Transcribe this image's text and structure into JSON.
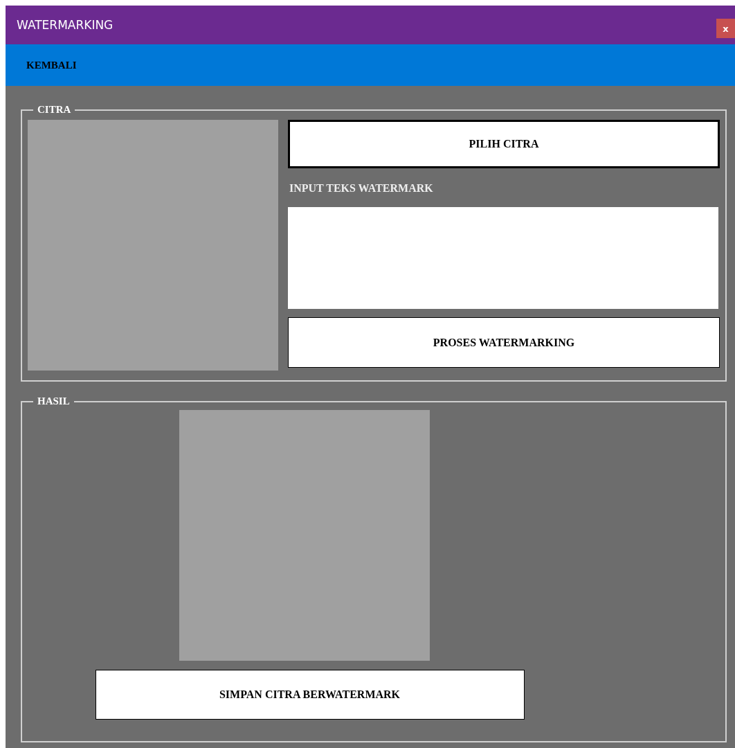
{
  "window": {
    "title": "WATERMARKING",
    "close_button": "x"
  },
  "menu_bar": {
    "items": [
      "KEMBALI"
    ]
  },
  "citra_group": {
    "legend": "CITRA",
    "choose_button": "PILIH CITRA",
    "input_label": "INPUT TEKS WATERMARK",
    "process_button": "PROSES WATERMARKING"
  },
  "hasil_group": {
    "legend": "HASIL",
    "save_button": "SIMPAN CITRA BERWATERMARK"
  }
}
